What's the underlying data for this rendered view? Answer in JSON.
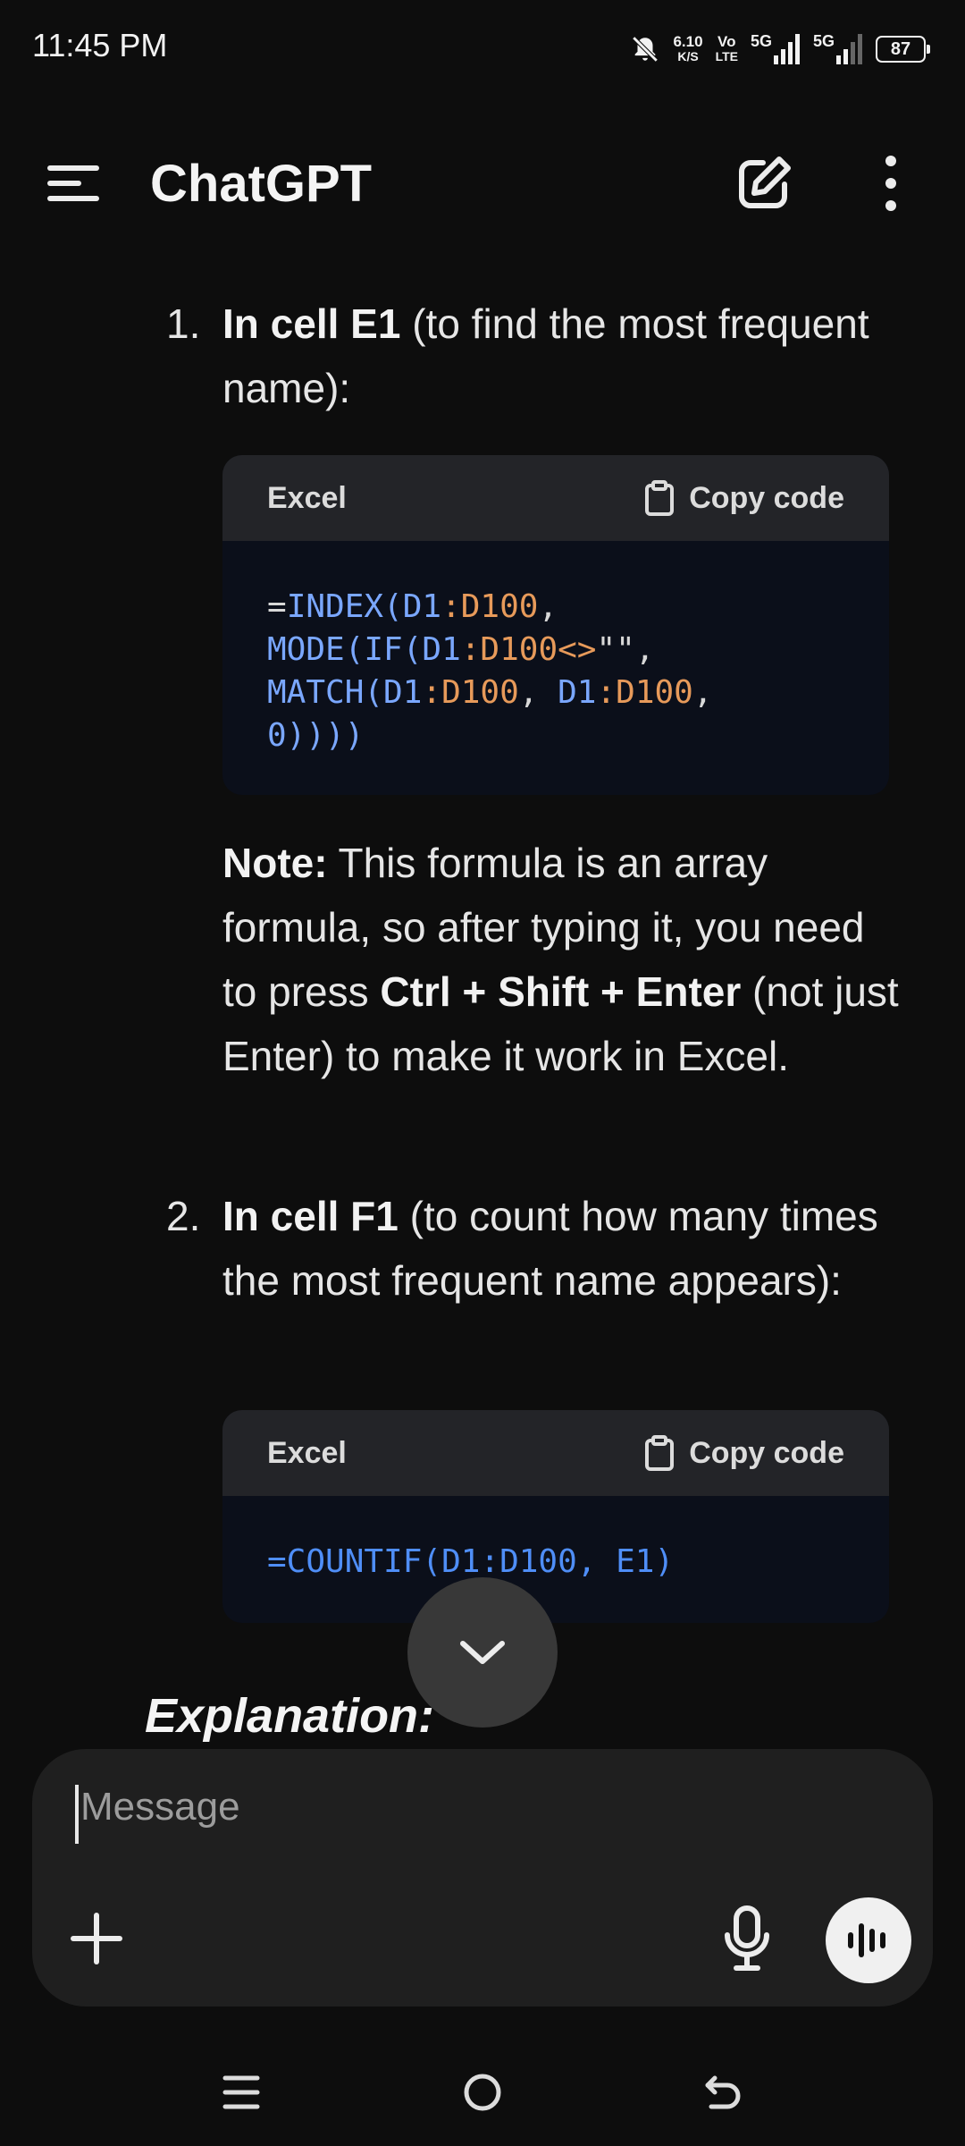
{
  "status_bar": {
    "time": "11:45 PM",
    "net_speed_value": "6.10",
    "net_speed_unit": "K/S",
    "volte_top": "Vo",
    "volte_bottom": "LTE",
    "sim1_label": "5G",
    "sim2_label": "5G",
    "battery": "87"
  },
  "app_bar": {
    "title": "ChatGPT"
  },
  "messages": {
    "step1": {
      "number": "1.",
      "bold": "In cell E1",
      "rest": " (to find the most frequent name):"
    },
    "code1": {
      "language": "Excel",
      "copy_label": "Copy code",
      "lines": [
        "=INDEX(D1:D100,",
        "MODE(IF(D1:D100<>\"\",",
        "MATCH(D1:D100, D1:D100,",
        "0))))"
      ]
    },
    "note": {
      "label": "Note:",
      "text1": " This formula is an array formula, so after typing it, you need to press ",
      "keys": "Ctrl + Shift + Enter",
      "text2": " (not just Enter) to make it work in Excel."
    },
    "step2": {
      "number": "2.",
      "bold": "In cell F1",
      "rest": " (to count how many times the most frequent name appears):"
    },
    "code2": {
      "language": "Excel",
      "copy_label": "Copy code",
      "line": "=COUNTIF(D1:D100, E1)"
    },
    "explanation_heading": "Explanation:"
  },
  "composer": {
    "placeholder": "Message"
  },
  "icons": {
    "menu": "menu-icon",
    "edit": "edit-icon",
    "more": "more-vertical-icon",
    "copy": "clipboard-icon",
    "scroll": "chevron-down-icon",
    "plus": "plus-icon",
    "mic": "mic-icon",
    "voice": "voice-wave-icon",
    "nav_recents": "recents-icon",
    "nav_home": "home-icon",
    "nav_back": "back-icon"
  },
  "colors": {
    "background": "#0d0d0d",
    "code_bg": "#0b0f1a",
    "code_header": "#232428",
    "code_blue": "#7aa7ff",
    "code_orange": "#e79a5a",
    "composer_bg": "#1f1f1f"
  }
}
